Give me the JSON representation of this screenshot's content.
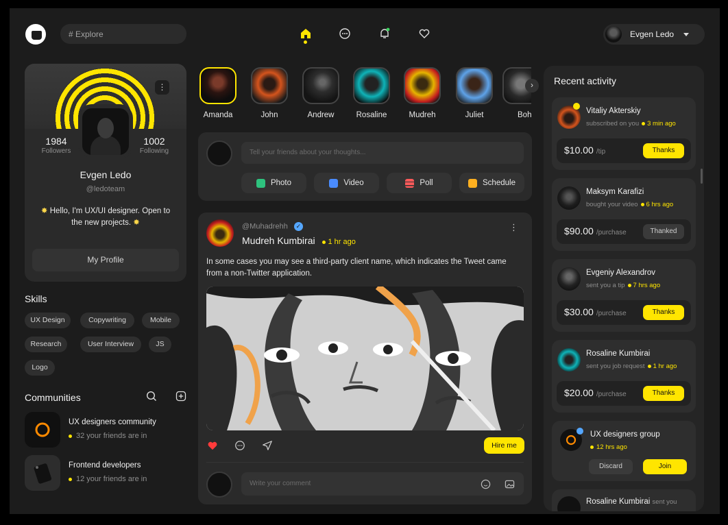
{
  "search": {
    "placeholder": "# Explore"
  },
  "user": {
    "name": "Evgen Ledo"
  },
  "nav": {
    "home": "home-icon",
    "messages": "chat-icon",
    "notifications": "bell-icon",
    "favorites": "heart-icon"
  },
  "profile": {
    "followers_count": "1984",
    "followers_label": "Followers",
    "following_count": "1002",
    "following_label": "Following",
    "name": "Evgen Ledo",
    "handle": "@ledoteam",
    "bio_line1": "Hello, I'm UX/UI designer. Open to",
    "bio_line2": "the new projects.",
    "button": "My Profile"
  },
  "skills": {
    "title": "Skills",
    "items": [
      "UX Design",
      "Copywriting",
      "Mobile",
      "Research",
      "User Interview",
      "JS",
      "Logo"
    ]
  },
  "communities": {
    "title": "Communities",
    "items": [
      {
        "name": "UX designers community",
        "sub": "32 your friends are in"
      },
      {
        "name": "Frontend developers",
        "sub": "12 your friends are in"
      }
    ]
  },
  "stories": [
    "Amanda",
    "John",
    "Andrew",
    "Rosaline",
    "Mudreh",
    "Juliet",
    "Boh"
  ],
  "composer": {
    "placeholder": "Tell your friends about your thoughts...",
    "buttons": [
      "Photo",
      "Video",
      "Poll",
      "Schedule"
    ]
  },
  "post": {
    "handle": "@Muhadrehh",
    "name": "Mudreh Kumbirai",
    "time": "1 hr ago",
    "text": "In some cases you may see a third-party client name, which indicates the Tweet came from a non-Twitter application.",
    "hire": "Hire me",
    "comment_placeholder": "Write your comment"
  },
  "activity": {
    "title": "Recent activity",
    "items": [
      {
        "name": "Vitaliy Akterskiy",
        "sub": "subscribed on you",
        "time": "3 min ago",
        "amount": "$10.00",
        "kind": "/tip",
        "action": "Thanks"
      },
      {
        "name": "Maksym Karafizi",
        "sub": "bought your video",
        "time": "6 hrs ago",
        "amount": "$90.00",
        "kind": "/purchase",
        "action": "Thanked"
      },
      {
        "name": "Evgeniy Alexandrov",
        "sub": "sent you a tip",
        "time": "7 hrs ago",
        "amount": "$30.00",
        "kind": "/purchase",
        "action": "Thanks"
      },
      {
        "name": "Rosaline Kumbirai",
        "sub": "sent you job request",
        "time": "1 hr ago",
        "amount": "$20.00",
        "kind": "/purchase",
        "action": "Thanks"
      }
    ],
    "group": {
      "name": "UX designers group",
      "time": "12 hrs ago",
      "discard": "Discard",
      "join": "Join"
    },
    "partial": {
      "name": "Rosaline Kumbirai",
      "sub": "sent you"
    }
  },
  "colors": {
    "accent": "#ffe500",
    "background": "#1c1c1c",
    "card": "#2a2a2a",
    "verified": "#55a7ff",
    "like": "#ff3b3b"
  }
}
